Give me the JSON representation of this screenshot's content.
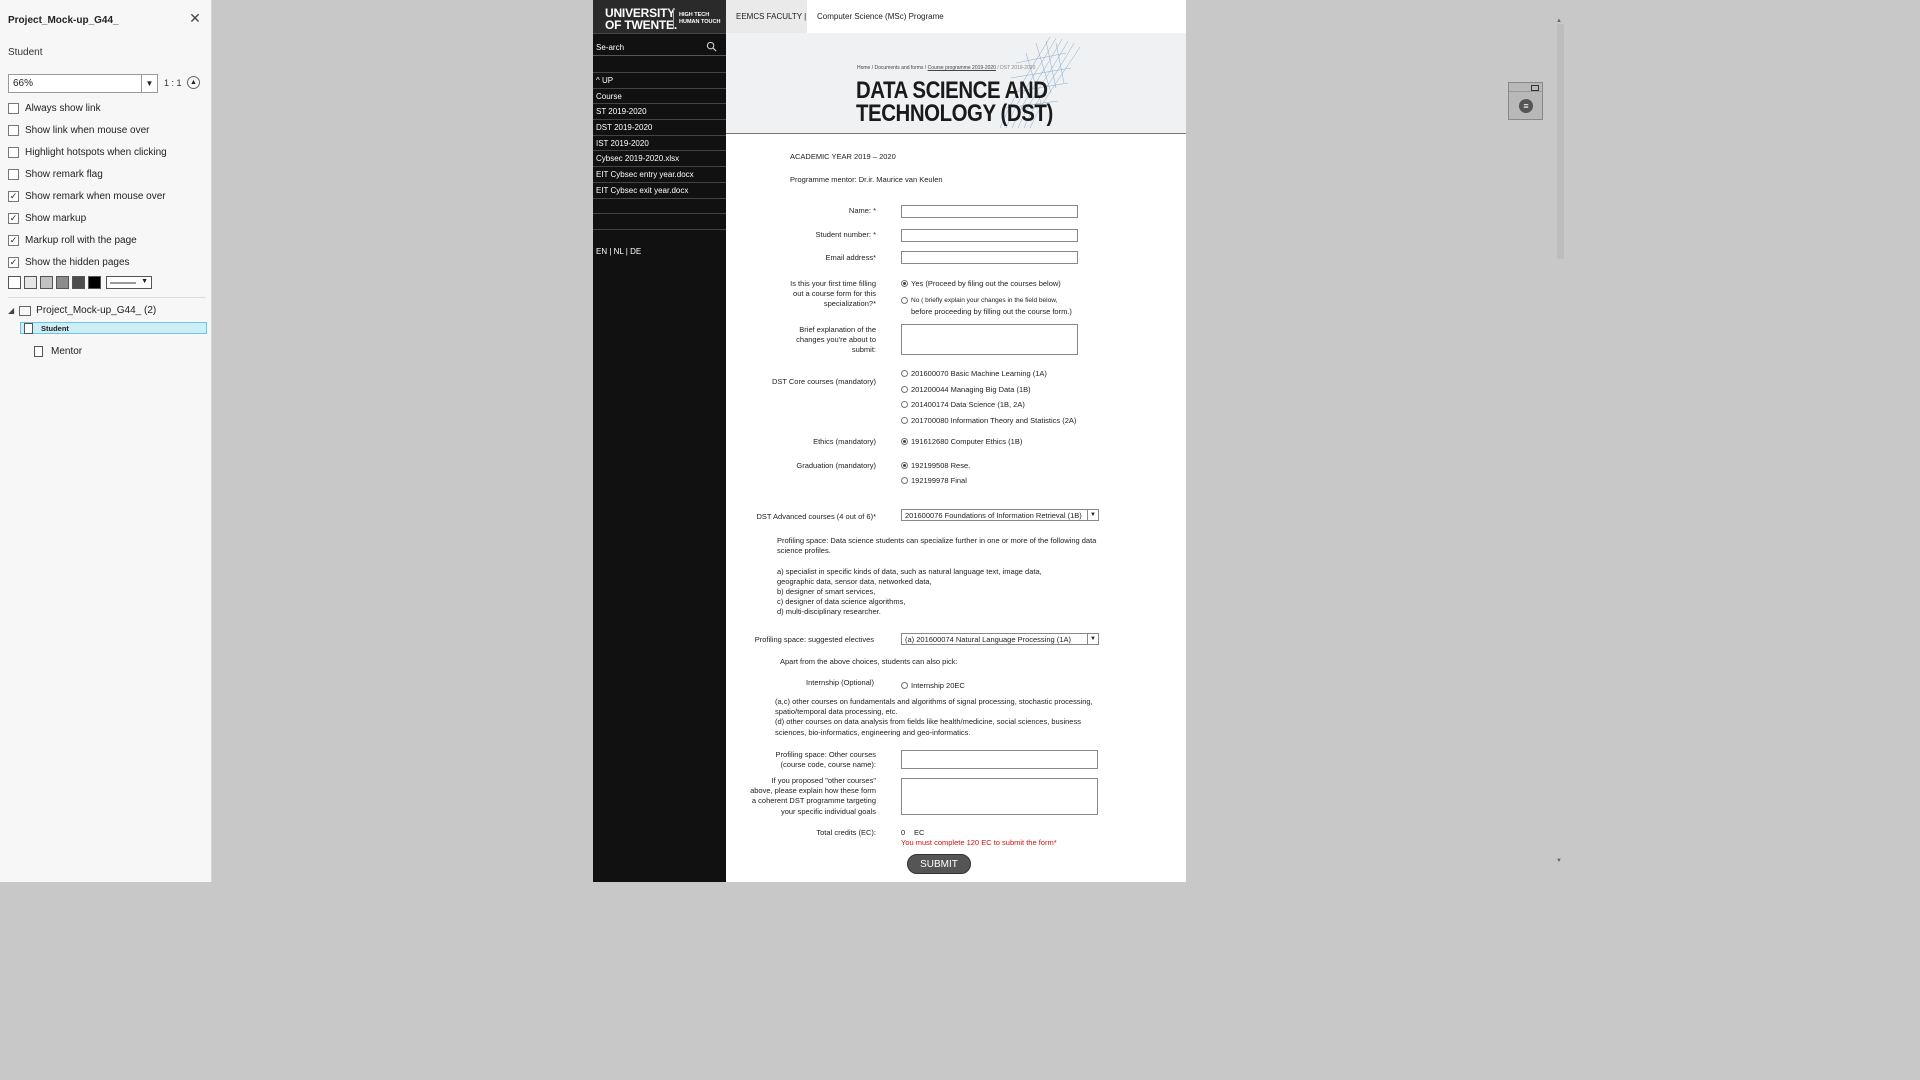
{
  "panel": {
    "title": "Project_Mock-up_G44_",
    "close_icon": "close-icon",
    "page_label": "Student",
    "zoom_value": "66%",
    "ratio_label": "1 : 1",
    "options": [
      {
        "label": "Always show link",
        "checked": false
      },
      {
        "label": "Show link when mouse over",
        "checked": false
      },
      {
        "label": "Highlight hotspots when clicking",
        "checked": false
      },
      {
        "label": "Show remark flag",
        "checked": false
      },
      {
        "label": "Show remark when mouse over",
        "checked": true
      },
      {
        "label": "Show markup",
        "checked": true
      },
      {
        "label": "Markup roll with the page",
        "checked": true
      },
      {
        "label": "Show the hidden pages",
        "checked": true
      }
    ],
    "swatches": [
      "#ffffff",
      "#e6e6e6",
      "#c2c2c2",
      "#8c8c8c",
      "#4d4d4d",
      "#000000"
    ],
    "tree": {
      "root": "Project_Mock-up_G44_ (2)",
      "items": [
        "Student",
        "Mentor"
      ],
      "selected": "Student"
    }
  },
  "site": {
    "logo_line1": "UNIVERSITY",
    "logo_line2": "OF TWENTE.",
    "tag_line1": "HIGH TECH",
    "tag_line2": "HUMAN TOUCH",
    "search_placeholder": "Se-arch",
    "nav": [
      "^ UP",
      "Course",
      "ST 2019-2020",
      "DST 2019-2020",
      "IST 2019-2020",
      "Cybsec 2019-2020.xlsx",
      "EIT Cybsec entry year.docx",
      "EIT Cybsec exit year.docx"
    ],
    "languages": "EN   |   NL   |   DE",
    "faculty": "EEMCS FACULTY  |",
    "programme": "Computer Science (MSc) Programe",
    "breadcrumb_home": "Home / Documents and forms / ",
    "breadcrumb_link": "Course programme 2019-2020",
    "breadcrumb_current": " / DST 2019-2020",
    "hero_title_line1": "DATA SCIENCE AND",
    "hero_title_line2": "TECHNOLOGY (DST)"
  },
  "form": {
    "academic_year": "ACADEMIC YEAR 2019 – 2020",
    "mentor": "Programme mentor: Dr.ir. Maurice van Keulen",
    "name_label": "Name: *",
    "student_number_label": "Student number: *",
    "email_label": "Email address*",
    "first_time_label_1": "Is this your first time filling",
    "first_time_label_2": "out a course form for this",
    "first_time_label_3": "specialization?*",
    "first_time_yes": "Yes  (Proceed by filing out the courses below)",
    "first_time_no_1": "No ( briefly explain your changes in the field below,",
    "first_time_no_2": "before proceeding by filling out the course form.)",
    "explanation_label_1": "Brief explanation of the",
    "explanation_label_2": "changes you're about to",
    "explanation_label_3": "submit:",
    "core_label": "DST Core courses (mandatory)",
    "core_courses": [
      "201600070 Basic Machine Learning (1A)",
      "201200044 Managing Big Data (1B)",
      "201400174 Data Science (1B, 2A)",
      "201700080 Information Theory and Statistics (2A)"
    ],
    "ethics_label": "Ethics (mandatory)",
    "ethics_course": "191612680 Computer Ethics (1B)",
    "graduation_label": "Graduation (mandatory)",
    "graduation_courses": [
      "192199508 Rese.",
      "192199978 Final"
    ],
    "advanced_label": "DST Advanced courses (4 out of 6)*",
    "advanced_selected": "201600076 Foundations of Information Retrieval (1B)",
    "profiling_text": [
      "Profiling space: Data science students can specialize further in one or more of the following data",
      "science profiles.",
      "",
      "a) specialist in specific kinds of data, such as natural language text, image data,",
      "geographic data, sensor data, networked data,",
      "b) designer of smart services,",
      "c) designer of data science algorithms,",
      "d) multi-disciplinary researcher."
    ],
    "electives_label": "Profiling space: suggested electives",
    "electives_selected": "(a) 201600074 Natural Language Processing (1A)",
    "apart_text": "Apart from the above choices, students can also pick:",
    "internship_label": "Internship (Optional)",
    "internship_option": "Internship 20EC",
    "other_text": [
      "(a,c) other courses on fundamentals and algorithms of signal processing, stochastic processing,",
      "spatio/temporal data processing, etc.",
      "(d) other courses on data analysis from fields like health/medicine, social sciences, business",
      "sciences, bio-informatics, engineering and geo-informatics."
    ],
    "other_courses_label_1": "Profiling space: Other courses",
    "other_courses_label_2": "(course code, course name):",
    "proposal_label": [
      "If you proposed \"other courses\"",
      "above, please explain how these form",
      "a coherent DST programme targeting",
      "your specific individual goals"
    ],
    "total_label": "Total credits (EC):",
    "total_value": "0",
    "total_unit": "EC",
    "warning": "You must complete 120 EC to submit the form*",
    "submit": "SUBMIT"
  }
}
